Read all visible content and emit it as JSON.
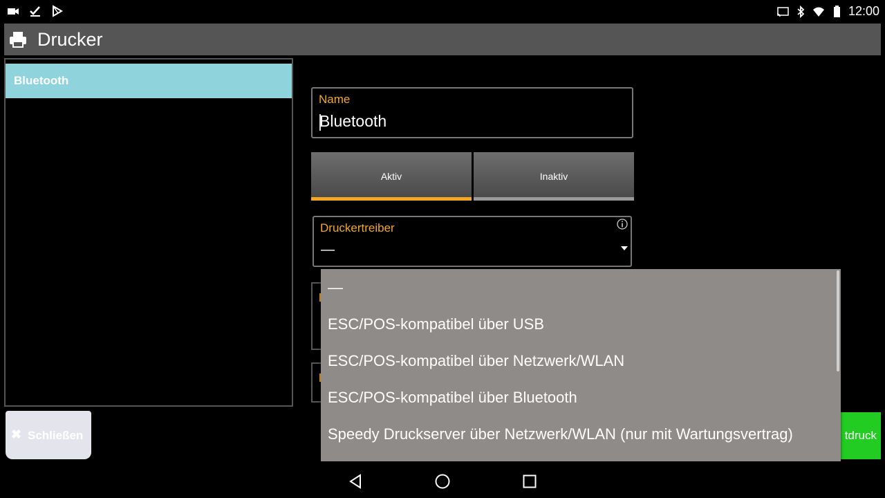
{
  "statusbar": {
    "time": "12:00",
    "left_icons": [
      "video-icon",
      "checkmark-icon",
      "play-store-icon"
    ],
    "right_icons": [
      "cast-icon",
      "bluetooth-icon",
      "wifi-icon",
      "battery-icon"
    ]
  },
  "actionbar": {
    "icon": "printer-icon",
    "title": "Drucker"
  },
  "sidebar": {
    "items": [
      {
        "label": "Bluetooth",
        "selected": true
      }
    ]
  },
  "close_button": {
    "label": "Schließen",
    "icon": "close-icon"
  },
  "form": {
    "name_label": "Name",
    "name_value": "Bluetooth",
    "status_active_label": "Aktiv",
    "status_inactive_label": "Inaktiv",
    "status_selected": "Aktiv",
    "driver_label": "Druckertreiber",
    "driver_value": "—"
  },
  "test_print_button": {
    "label_visible": "tdruck"
  },
  "driver_dropdown": {
    "options": [
      "—",
      "ESC/POS-kompatibel über USB",
      "ESC/POS-kompatibel über Netzwerk/WLAN",
      "ESC/POS-kompatibel über Bluetooth",
      "Speedy Druckserver über Netzwerk/WLAN (nur mit Wartungsvertrag)"
    ]
  },
  "navbar": {
    "buttons": [
      "back-icon",
      "home-icon",
      "recents-icon"
    ]
  },
  "colors": {
    "accent": "#f5a623",
    "selected_row": "#8fd3dc",
    "actionbar": "#555555",
    "dropdown_bg": "#8f8b88",
    "green_button": "#22cc22"
  }
}
